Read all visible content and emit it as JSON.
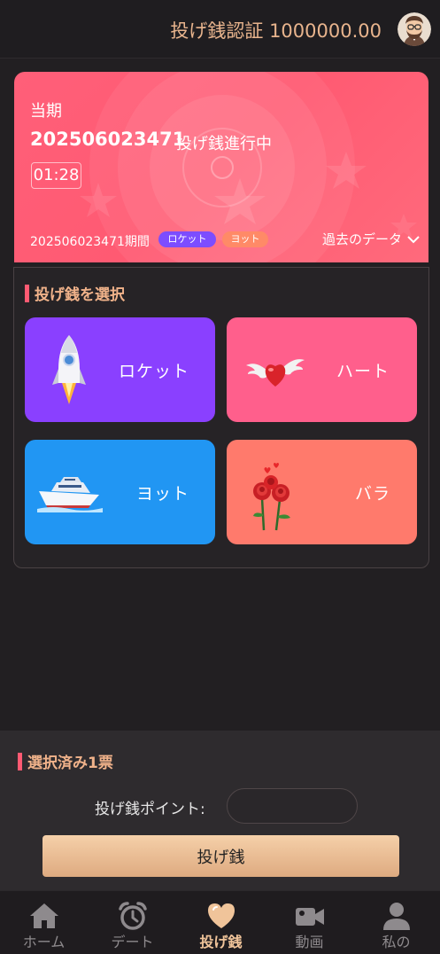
{
  "header": {
    "title": "投げ銭認証 1000000.00"
  },
  "period": {
    "label": "当期",
    "issue": "202506023471",
    "status": "投げ銭進行中",
    "timer": "01:28",
    "last_issue": "202506023471期間",
    "last_results": [
      "ロケット",
      "ヨット"
    ],
    "history_label": "過去のデータ"
  },
  "select": {
    "title": "投げ銭を選択",
    "gifts": [
      {
        "label": "ロケット",
        "icon": "rocket-icon"
      },
      {
        "label": "ハート",
        "icon": "winged-heart-icon"
      },
      {
        "label": "ヨット",
        "icon": "yacht-icon"
      },
      {
        "label": "バラ",
        "icon": "rose-icon"
      }
    ]
  },
  "selection": {
    "title": "選択済み1票",
    "points_label": "投げ銭ポイント:",
    "points_value": "",
    "submit_label": "投げ銭"
  },
  "nav": {
    "items": [
      {
        "label": "ホーム",
        "icon": "home-icon"
      },
      {
        "label": "デート",
        "icon": "alarm-clock-icon"
      },
      {
        "label": "投げ銭",
        "icon": "heart-icon",
        "active": true
      },
      {
        "label": "動画",
        "icon": "video-icon"
      },
      {
        "label": "私の",
        "icon": "user-icon"
      }
    ]
  },
  "colors": {
    "accent": "#e8b48d",
    "card": "#ff5f79",
    "rocket": "#8a40ff",
    "heart": "#ff5f8c",
    "yacht": "#2196f3",
    "rose": "#ff7a6c"
  }
}
